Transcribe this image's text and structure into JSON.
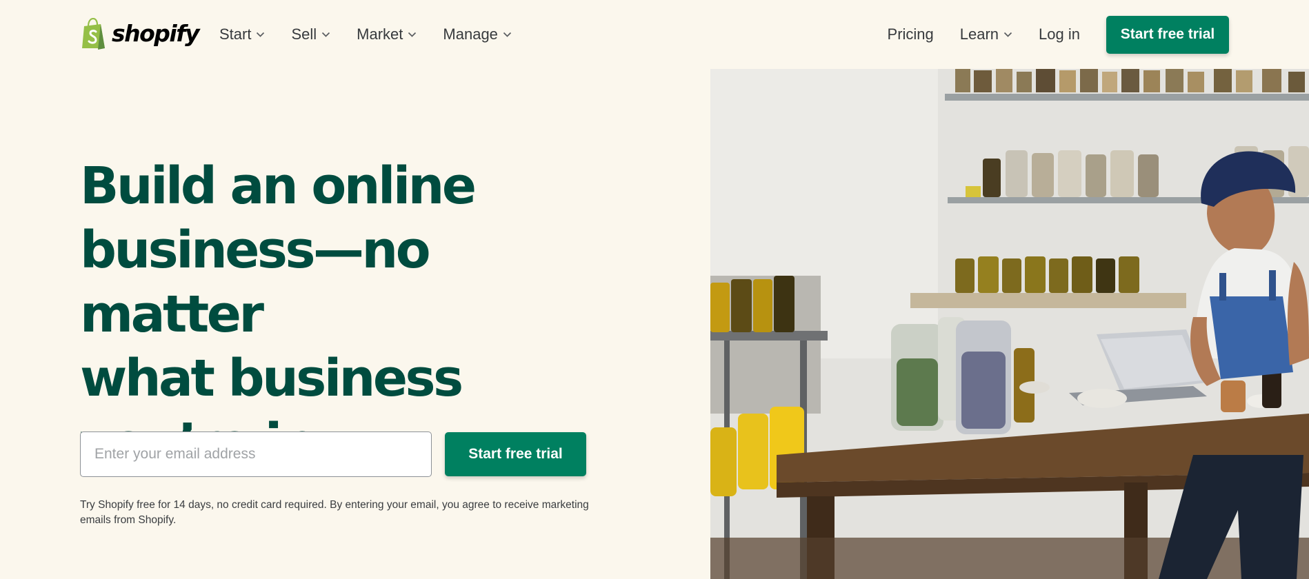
{
  "brand": {
    "name": "shopify",
    "color_primary": "#008060",
    "color_heading": "#004c3f",
    "color_logo_green": "#95bf47",
    "background": "#fbf7ed"
  },
  "nav": {
    "left_items": [
      {
        "label": "Start",
        "icon": "chevron-down-icon"
      },
      {
        "label": "Sell",
        "icon": "chevron-down-icon"
      },
      {
        "label": "Market",
        "icon": "chevron-down-icon"
      },
      {
        "label": "Manage",
        "icon": "chevron-down-icon"
      }
    ],
    "pricing": "Pricing",
    "learn": "Learn",
    "login": "Log in",
    "cta": "Start free trial"
  },
  "hero": {
    "title_lines": [
      "Build an online",
      "business—no matter",
      "what business",
      "you’re in"
    ],
    "email_placeholder": "Enter your email address",
    "email_value": "",
    "cta": "Start free trial",
    "disclaimer": "Try Shopify free for 14 days, no credit card required. By entering your email, you agree to receive marketing emails from Shopify."
  },
  "image": {
    "subject": "woman-working-on-laptop-in-herb-shop"
  }
}
